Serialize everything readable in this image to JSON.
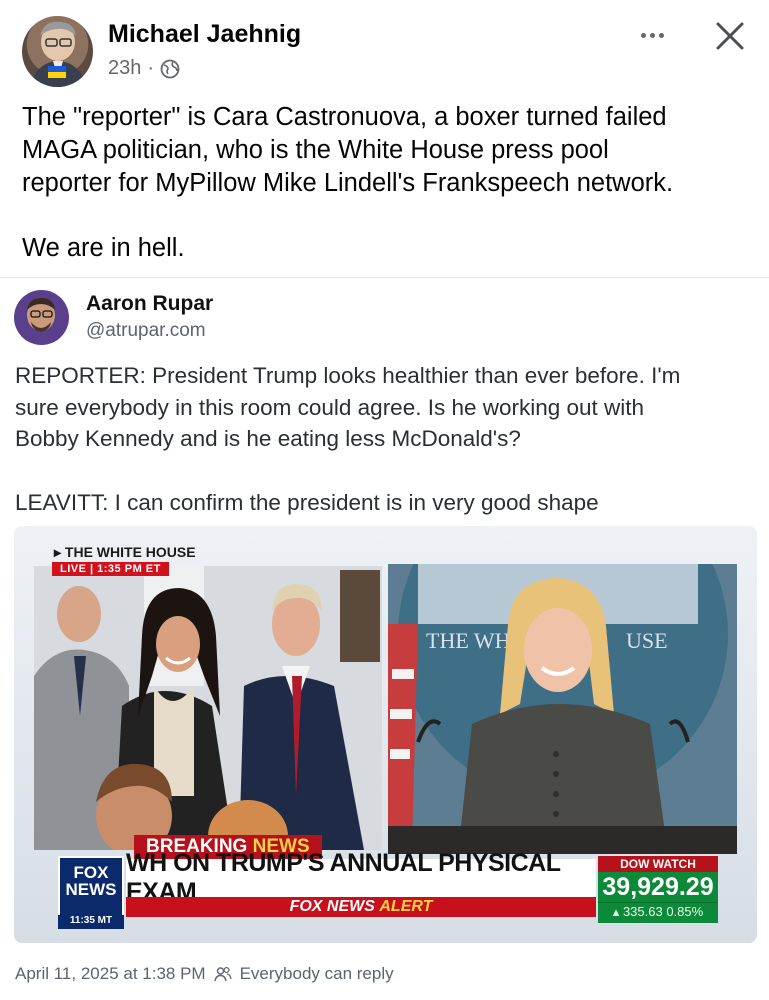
{
  "post": {
    "author": "Michael Jaehnig",
    "time": "23h",
    "separator": "·",
    "privacy_icon": "globe-icon",
    "more_icon": "more-horizontal-icon",
    "close_icon": "close-icon",
    "text_lines": [
      "The \"reporter\" is Cara Castronuova, a boxer turned failed",
      "MAGA politician, who is the White House press pool",
      "reporter for MyPillow Mike Lindell's Frankspeech network."
    ],
    "text_last": "We are in hell."
  },
  "embed": {
    "author": "Aaron Rupar",
    "handle": "@atrupar.com",
    "quote_lines": [
      "REPORTER: President Trump looks healthier than ever before. I'm",
      "sure everybody in this room could agree. Is he working out with",
      "Bobby Kennedy and is he eating less McDonald's?"
    ],
    "quote_last": "LEAVITT: I can confirm the president is in very good shape",
    "footer_date": "April 11, 2025 at 1:38 PM",
    "footer_reply": "Everybody can reply",
    "footer_icon": "people-icon"
  },
  "video": {
    "wh_tag": "THE WHITE HOUSE",
    "live_label": "LIVE",
    "live_time": "1:35 PM ET",
    "podium_text": "THE WH",
    "podium_text2": "USE",
    "breaking_label": "BREAKING",
    "breaking_news": "NEWS",
    "headline": "WH ON TRUMP'S ANNUAL PHYSICAL EXAM",
    "alert_prefix": "FOX NEWS",
    "alert_word": "ALERT",
    "fox_logo_line1": "FOX",
    "fox_logo_line2": "NEWS",
    "fox_time": "11:35 MT",
    "dow_label": "DOW WATCH",
    "dow_value": "39,929.29",
    "dow_change": "335.63",
    "dow_pct": "0.85%"
  },
  "colors": {
    "text_primary": "#050505",
    "text_secondary": "#65676b",
    "fox_red": "#b5121b",
    "fox_blue": "#0a2a6b",
    "dow_green": "#0c8a3a",
    "alert_yellow": "#ffd23f"
  }
}
